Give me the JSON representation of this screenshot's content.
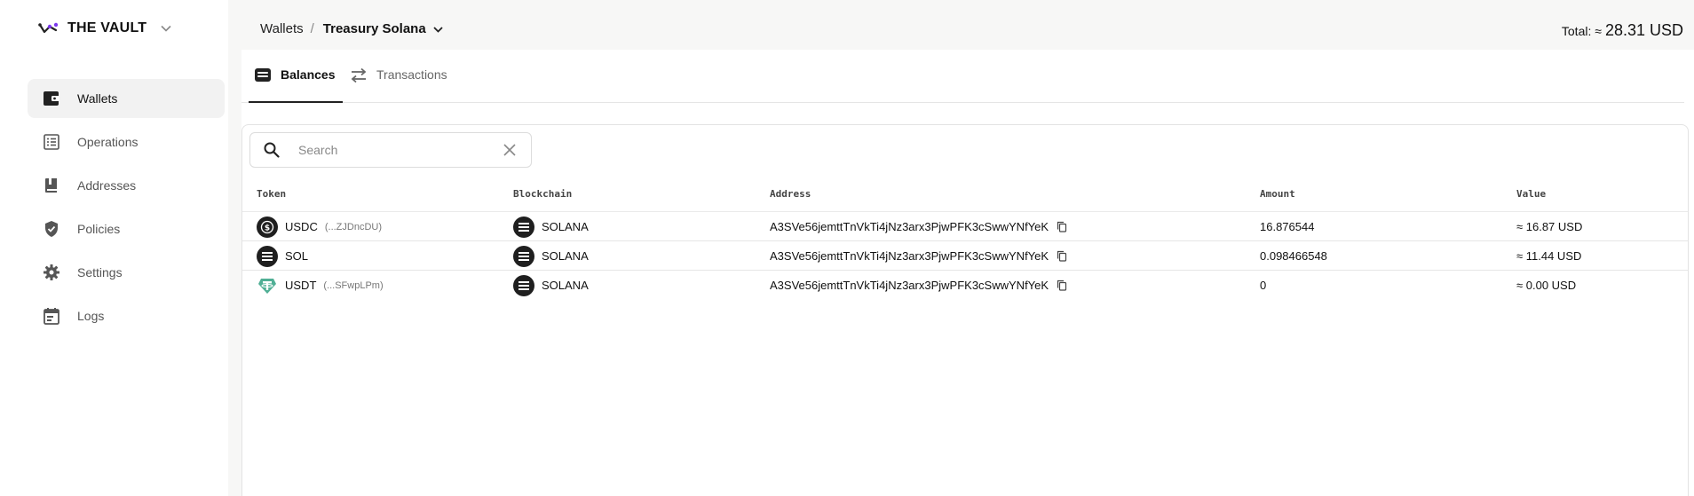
{
  "brand": {
    "name": "THE VAULT",
    "logo_icon": "vault-logo-icon"
  },
  "sidebar": {
    "items": [
      {
        "label": "Wallets",
        "icon": "wallet-icon",
        "active": true
      },
      {
        "label": "Operations",
        "icon": "list-icon",
        "active": false
      },
      {
        "label": "Addresses",
        "icon": "book-icon",
        "active": false
      },
      {
        "label": "Policies",
        "icon": "shield-icon",
        "active": false
      },
      {
        "label": "Settings",
        "icon": "gear-icon",
        "active": false
      },
      {
        "label": "Logs",
        "icon": "calendar-icon",
        "active": false
      }
    ]
  },
  "header": {
    "breadcrumb_root": "Wallets",
    "breadcrumb_sep": "/",
    "current_wallet": "Treasury Solana",
    "total_label": "Total: ≈",
    "total_value": "28.31 USD"
  },
  "tabs": [
    {
      "label": "Balances",
      "icon": "wallet-card-icon",
      "active": true
    },
    {
      "label": "Transactions",
      "icon": "swap-arrows-icon",
      "active": false
    }
  ],
  "search": {
    "placeholder": "Search",
    "value": ""
  },
  "table": {
    "columns": [
      "Token",
      "Blockchain",
      "Address",
      "Amount",
      "Value"
    ],
    "rows": [
      {
        "token": "USDC",
        "token_addr": "(...ZJDncDU)",
        "token_icon": "usdc-icon",
        "blockchain": "SOLANA",
        "address": "A3SVe56jemttTnVkTi4jNz3arx3PjwPFK3cSwwYNfYeK",
        "amount": "16.876544",
        "value": "≈ 16.87 USD"
      },
      {
        "token": "SOL",
        "token_addr": "",
        "token_icon": "solana-icon",
        "blockchain": "SOLANA",
        "address": "A3SVe56jemttTnVkTi4jNz3arx3PjwPFK3cSwwYNfYeK",
        "amount": "0.098466548",
        "value": "≈ 11.44 USD"
      },
      {
        "token": "USDT",
        "token_addr": "(...SFwpLPm)",
        "token_icon": "usdt-icon",
        "blockchain": "SOLANA",
        "address": "A3SVe56jemttTnVkTi4jNz3arx3PjwPFK3cSwwYNfYeK",
        "amount": "0",
        "value": "≈ 0.00 USD"
      }
    ]
  },
  "colors": {
    "usdt": "#50af95",
    "dark": "#1f1f1f",
    "active_bg": "#f2f2f2",
    "brand_purple": "#7c3aed"
  }
}
